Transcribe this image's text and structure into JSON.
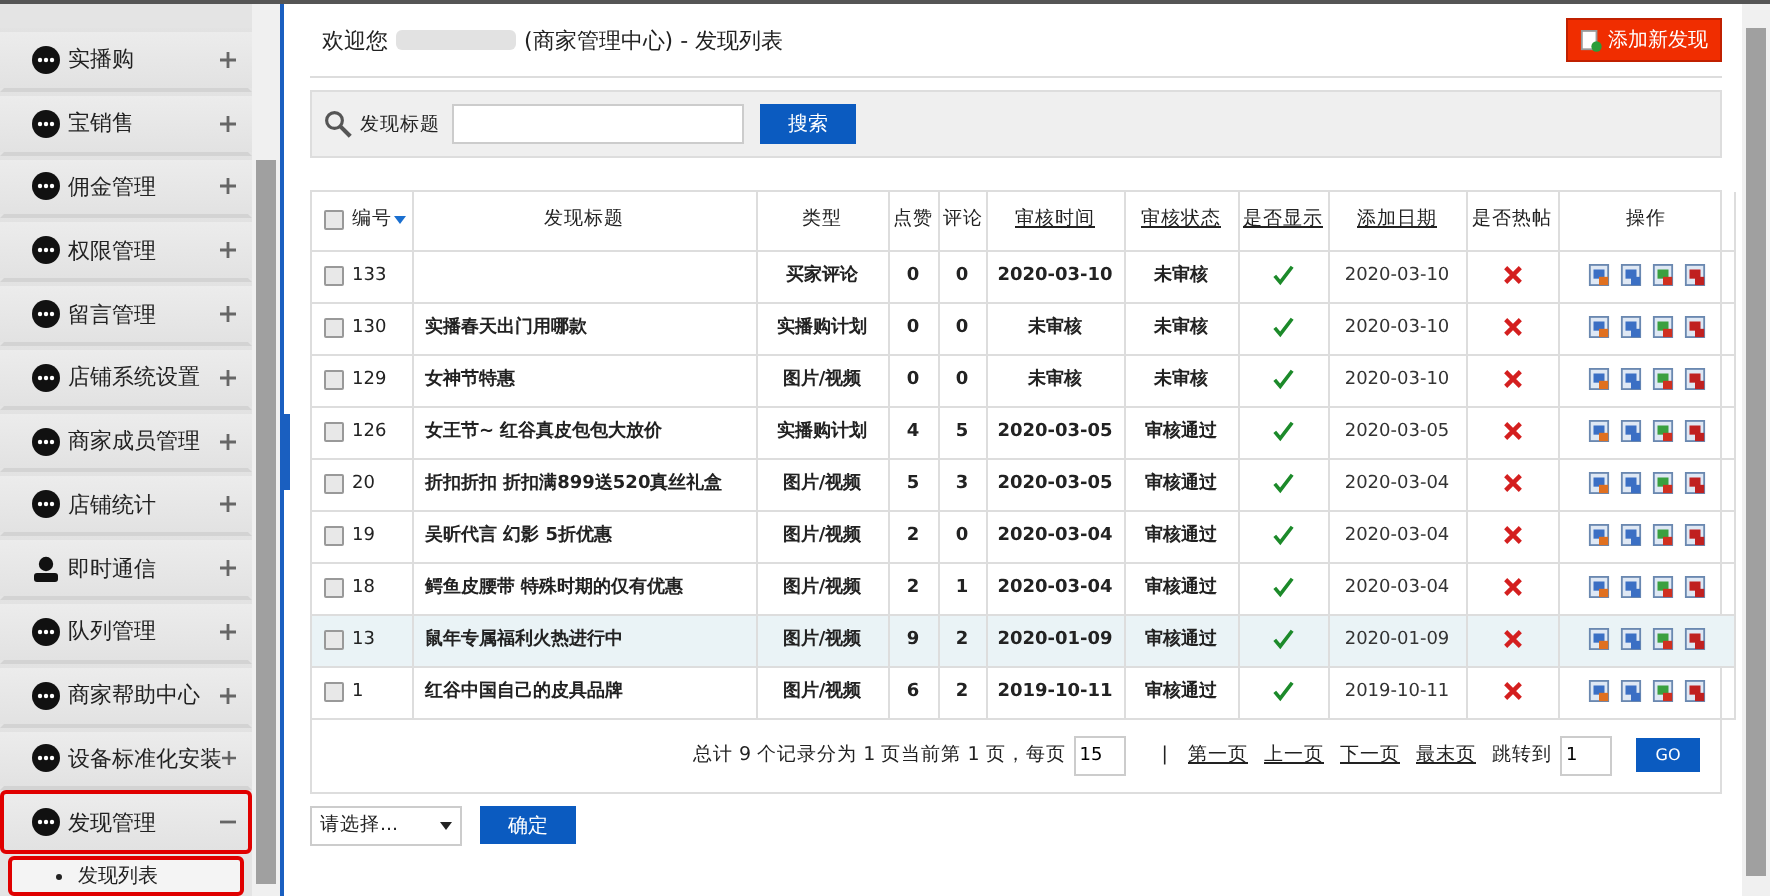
{
  "sidebar": {
    "items": [
      {
        "label": "实播购",
        "kind": "dots",
        "expanded": false,
        "highlighted": false
      },
      {
        "label": "宝销售",
        "kind": "dots",
        "expanded": false,
        "highlighted": false
      },
      {
        "label": "佣金管理",
        "kind": "dots",
        "expanded": false,
        "highlighted": false
      },
      {
        "label": "权限管理",
        "kind": "dots",
        "expanded": false,
        "highlighted": false
      },
      {
        "label": "留言管理",
        "kind": "dots",
        "expanded": false,
        "highlighted": false
      },
      {
        "label": "店铺系统设置",
        "kind": "dots",
        "expanded": false,
        "highlighted": false
      },
      {
        "label": "商家成员管理",
        "kind": "dots",
        "expanded": false,
        "highlighted": false
      },
      {
        "label": "店铺统计",
        "kind": "dots",
        "expanded": false,
        "highlighted": false
      },
      {
        "label": "即时通信",
        "kind": "person",
        "expanded": false,
        "highlighted": false
      },
      {
        "label": "队列管理",
        "kind": "dots",
        "expanded": false,
        "highlighted": false
      },
      {
        "label": "商家帮助中心",
        "kind": "dots",
        "expanded": false,
        "highlighted": false
      },
      {
        "label": "设备标准化安装",
        "kind": "dots",
        "expanded": false,
        "highlighted": false
      },
      {
        "label": "发现管理",
        "kind": "dots",
        "expanded": true,
        "highlighted": true,
        "children": [
          {
            "label": "发现列表",
            "highlighted": true
          }
        ]
      }
    ]
  },
  "header": {
    "welcome": "欢迎您",
    "suffix": "(商家管理中心) - 发现列表",
    "add_button": "添加新发现"
  },
  "search": {
    "label": "发现标题",
    "button": "搜索"
  },
  "table": {
    "select_all_checked": false,
    "columns": [
      {
        "label": "编号",
        "sortable": false,
        "sorted": true
      },
      {
        "label": "发现标题",
        "sortable": false,
        "sorted": false
      },
      {
        "label": "类型",
        "sortable": false,
        "sorted": false
      },
      {
        "label": "点赞",
        "sortable": false,
        "sorted": false
      },
      {
        "label": "评论",
        "sortable": false,
        "sorted": false
      },
      {
        "label": "审核时间",
        "sortable": true,
        "sorted": false
      },
      {
        "label": "审核状态",
        "sortable": true,
        "sorted": false
      },
      {
        "label": "是否显示",
        "sortable": true,
        "sorted": false
      },
      {
        "label": "添加日期",
        "sortable": true,
        "sorted": false
      },
      {
        "label": "是否热帖",
        "sortable": false,
        "sorted": false
      },
      {
        "label": "操作",
        "sortable": false,
        "sorted": false
      }
    ],
    "rows": [
      {
        "id": "133",
        "checked": false,
        "highlighted": false,
        "title": "",
        "type": "买家评论",
        "likes": "0",
        "comments": "0",
        "review_time": "2020-03-10",
        "review_status": "未审核",
        "shown": true,
        "date": "2020-03-10",
        "hot": false
      },
      {
        "id": "130",
        "checked": false,
        "highlighted": false,
        "title": "实播春天出门用哪款",
        "type": "实播购计划",
        "likes": "0",
        "comments": "0",
        "review_time": "未审核",
        "review_status": "未审核",
        "shown": true,
        "date": "2020-03-10",
        "hot": false
      },
      {
        "id": "129",
        "checked": false,
        "highlighted": false,
        "title": "女神节特惠",
        "type": "图片/视频",
        "likes": "0",
        "comments": "0",
        "review_time": "未审核",
        "review_status": "未审核",
        "shown": true,
        "date": "2020-03-10",
        "hot": false
      },
      {
        "id": "126",
        "checked": false,
        "highlighted": false,
        "title": "女王节~ 红谷真皮包包大放价",
        "type": "实播购计划",
        "likes": "4",
        "comments": "5",
        "review_time": "2020-03-05",
        "review_status": "审核通过",
        "shown": true,
        "date": "2020-03-05",
        "hot": false
      },
      {
        "id": "20",
        "checked": false,
        "highlighted": false,
        "title": "折扣折扣 折扣满899送520真丝礼盒",
        "type": "图片/视频",
        "likes": "5",
        "comments": "3",
        "review_time": "2020-03-05",
        "review_status": "审核通过",
        "shown": true,
        "date": "2020-03-04",
        "hot": false
      },
      {
        "id": "19",
        "checked": false,
        "highlighted": false,
        "title": "吴昕代言 幻影 5折优惠",
        "type": "图片/视频",
        "likes": "2",
        "comments": "0",
        "review_time": "2020-03-04",
        "review_status": "审核通过",
        "shown": true,
        "date": "2020-03-04",
        "hot": false
      },
      {
        "id": "18",
        "checked": false,
        "highlighted": false,
        "title": "鳄鱼皮腰带 特殊时期的仅有优惠",
        "type": "图片/视频",
        "likes": "2",
        "comments": "1",
        "review_time": "2020-03-04",
        "review_status": "审核通过",
        "shown": true,
        "date": "2020-03-04",
        "hot": false
      },
      {
        "id": "13",
        "checked": false,
        "highlighted": true,
        "title": "鼠年专属福利火热进行中",
        "type": "图片/视频",
        "likes": "9",
        "comments": "2",
        "review_time": "2020-01-09",
        "review_status": "审核通过",
        "shown": true,
        "date": "2020-01-09",
        "hot": false
      },
      {
        "id": "1",
        "checked": false,
        "highlighted": false,
        "title": "红谷中国自己的皮具品牌",
        "type": "图片/视频",
        "likes": "6",
        "comments": "2",
        "review_time": "2019-10-11",
        "review_status": "审核通过",
        "shown": true,
        "date": "2019-10-11",
        "hot": false
      }
    ]
  },
  "pagination": {
    "summary": "总计 9 个记录分为 1 页当前第 1 页，每页",
    "per_page": "15",
    "separator": "|",
    "links": [
      "第一页",
      "上一页",
      "下一页",
      "最末页"
    ],
    "jump_label": "跳转到",
    "jump_value": "1",
    "go": "GO"
  },
  "footer": {
    "select": "请选择...",
    "confirm": "确定"
  }
}
